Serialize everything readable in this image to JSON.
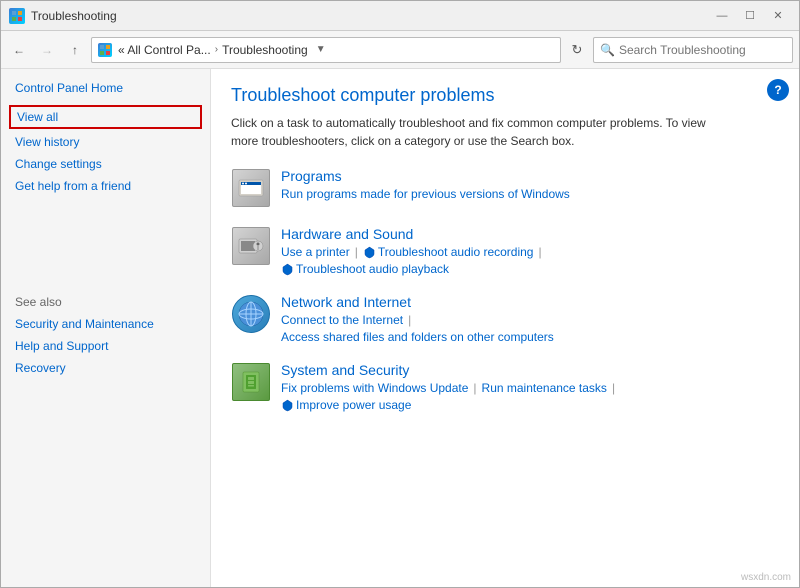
{
  "window": {
    "title": "Troubleshooting",
    "title_icon": "control-panel-icon"
  },
  "titlebar": {
    "minimize_label": "—",
    "maximize_label": "☐",
    "close_label": "✕"
  },
  "addressbar": {
    "back_disabled": false,
    "forward_disabled": false,
    "breadcrumb_prefix": "« All Control Pa...",
    "breadcrumb_sep": ">",
    "breadcrumb_current": "Troubleshooting",
    "search_placeholder": "Search Troubleshooting"
  },
  "sidebar": {
    "home_label": "Control Panel Home",
    "links": [
      {
        "label": "View all",
        "highlighted": true
      },
      {
        "label": "View history",
        "highlighted": false
      },
      {
        "label": "Change settings",
        "highlighted": false
      },
      {
        "label": "Get help from a friend",
        "highlighted": false
      }
    ],
    "see_also_label": "See also",
    "see_also_links": [
      "Security and Maintenance",
      "Help and Support",
      "Recovery"
    ]
  },
  "content": {
    "title": "Troubleshoot computer problems",
    "description": "Click on a task to automatically troubleshoot and fix common computer problems. To view more troubleshooters, click on a category or use the Search box.",
    "categories": [
      {
        "id": "programs",
        "title": "Programs",
        "subtitle": "Run programs made for previous versions of Windows",
        "links": []
      },
      {
        "id": "hardware",
        "title": "Hardware and Sound",
        "subtitle": "",
        "links": [
          {
            "label": "Use a printer",
            "has_shield": false
          },
          {
            "label": "Troubleshoot audio recording",
            "has_shield": true
          },
          {
            "label": "Troubleshoot audio playback",
            "has_shield": true
          }
        ]
      },
      {
        "id": "network",
        "title": "Network and Internet",
        "subtitle": "",
        "links": [
          {
            "label": "Connect to the Internet",
            "has_shield": false
          },
          {
            "label": "Access shared files and folders on other computers",
            "has_shield": false
          }
        ]
      },
      {
        "id": "security",
        "title": "System and Security",
        "subtitle": "",
        "links": [
          {
            "label": "Fix problems with Windows Update",
            "has_shield": false
          },
          {
            "label": "Run maintenance tasks",
            "has_shield": false
          },
          {
            "label": "Improve power usage",
            "has_shield": true
          }
        ]
      }
    ],
    "help_label": "?",
    "watermark": "wsxdn.com"
  }
}
